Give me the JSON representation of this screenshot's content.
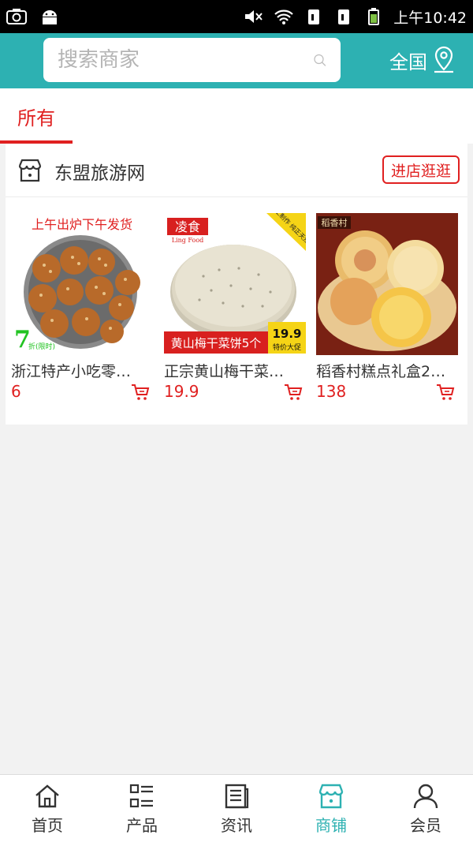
{
  "status_bar": {
    "time": "上午10:42"
  },
  "header": {
    "search_placeholder": "搜索商家",
    "region": "全国"
  },
  "tabs": {
    "active": "所有"
  },
  "shop": {
    "name": "东盟旅游网",
    "visit_button": "进店逛逛",
    "products": [
      {
        "title": "浙江特产小吃零…",
        "price": "6",
        "image_caption": "上午出炉下午发货",
        "badge": "7",
        "badge_note": "折(限时)"
      },
      {
        "title": "正宗黄山梅干菜…",
        "price": "19.9",
        "image_brand": "凌食",
        "image_brand_sub": "Ling Food",
        "image_banner": "黄山梅干菜饼5个",
        "image_price": "19.9",
        "image_price_note": "特价大促",
        "image_corner": "手工制作 纯正天然"
      },
      {
        "title": "稻香村糕点礼盒2…",
        "price": "138",
        "image_brand": "稻香村"
      }
    ]
  },
  "bottom_nav": [
    {
      "label": "首页",
      "icon": "home-icon",
      "active": false
    },
    {
      "label": "产品",
      "icon": "list-icon",
      "active": false
    },
    {
      "label": "资讯",
      "icon": "news-icon",
      "active": false
    },
    {
      "label": "商铺",
      "icon": "store-icon",
      "active": true
    },
    {
      "label": "会员",
      "icon": "user-icon",
      "active": false
    }
  ],
  "colors": {
    "accent": "#2db1b2",
    "red": "#e02020"
  }
}
